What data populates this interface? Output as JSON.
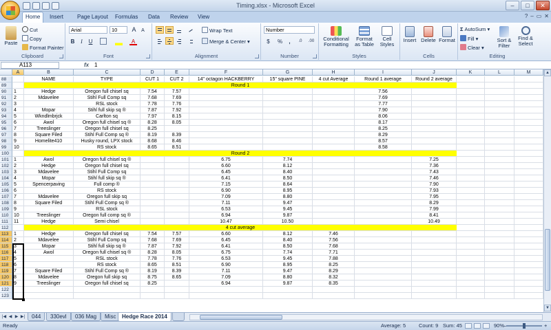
{
  "app": {
    "title": "Timing.xlsx - Microsoft Excel"
  },
  "window_controls": {
    "minimize": "–",
    "maximize": "□",
    "close": "✕"
  },
  "mdi_controls": {
    "minimize": "–",
    "restore": "▭",
    "close": "✕",
    "help": "?"
  },
  "ribbon": {
    "tabs": [
      "Home",
      "Insert",
      "Page Layout",
      "Formulas",
      "Data",
      "Review",
      "View"
    ],
    "active_tab": "Home",
    "clipboard": {
      "paste": "Paste",
      "cut": "Cut",
      "copy": "Copy",
      "format_painter": "Format Painter",
      "label": "Clipboard"
    },
    "font": {
      "name": "Arial",
      "size": "10",
      "grow": "A",
      "shrink": "A",
      "bold": "B",
      "italic": "I",
      "underline": "U",
      "font_color_letter": "A",
      "label": "Font"
    },
    "alignment": {
      "wrap_text": "Wrap Text",
      "merge_center": "Merge & Center",
      "label": "Alignment"
    },
    "number": {
      "format": "Number",
      "currency": "$",
      "percent": "%",
      "comma": ",",
      "inc_decimal": ".0",
      "dec_decimal": ".00",
      "label": "Number"
    },
    "styles": {
      "conditional": "Conditional Formatting",
      "format_table": "Format as Table",
      "cell_styles": "Cell Styles",
      "label": "Styles"
    },
    "cells": {
      "insert": "Insert",
      "delete": "Delete",
      "format": "Format",
      "label": "Cells"
    },
    "editing": {
      "autosum": "AutoSum",
      "fill": "Fill",
      "clear": "Clear",
      "sort_filter": "Sort & Filter",
      "find_select": "Find & Select",
      "label": "Editing"
    }
  },
  "formula_bar": {
    "name_box": "A113",
    "fx": "fx",
    "value": "1"
  },
  "sheet": {
    "columns": [
      "A",
      "B",
      "C",
      "D",
      "E",
      "F",
      "G",
      "H",
      "I",
      "J",
      "K",
      "L",
      "M"
    ],
    "selected_column": "A",
    "header_row": {
      "row": "88",
      "cells": [
        "",
        "NAME",
        "TYPE",
        "CUT 1",
        "CUT 2",
        "14\" octagon HACKBERRY",
        "15\" square PINE",
        "4 cut Average",
        "Round 1 average",
        "Round 2 average",
        "",
        "",
        ""
      ]
    },
    "blank_row": "89",
    "rows": [
      {
        "row": "89",
        "band": "Round 1"
      },
      {
        "row": "90",
        "cells": [
          "1",
          "Hedge",
          "Oregon full chisel sq",
          "7.54",
          "7.57",
          "",
          "",
          "",
          "7.56",
          "",
          "",
          "",
          ""
        ]
      },
      {
        "row": "91",
        "cells": [
          "2",
          "Mdavelee",
          "Stihl Full Comp sq",
          "7.68",
          "7.69",
          "",
          "",
          "",
          "7.69",
          "",
          "",
          "",
          ""
        ]
      },
      {
        "row": "92",
        "cells": [
          "3",
          "",
          "RSL stock",
          "7.78",
          "7.76",
          "",
          "",
          "",
          "7.77",
          "",
          "",
          "",
          ""
        ]
      },
      {
        "row": "93",
        "cells": [
          "4",
          "Mopar",
          "Stihl full skip sq ®",
          "7.87",
          "7.92",
          "",
          "",
          "",
          "7.90",
          "",
          "",
          "",
          ""
        ]
      },
      {
        "row": "94",
        "cells": [
          "5",
          "Wkndlmbrjck",
          "Carlton sq",
          "7.97",
          "8.15",
          "",
          "",
          "",
          "8.06",
          "",
          "",
          "",
          ""
        ]
      },
      {
        "row": "95",
        "cells": [
          "6",
          "Awol",
          "Oregon full chisel sq ®",
          "8.28",
          "8.05",
          "",
          "",
          "",
          "8.17",
          "",
          "",
          "",
          ""
        ]
      },
      {
        "row": "96",
        "cells": [
          "7",
          "Treeslinger",
          "Oregon full chisel sq",
          "8.25",
          "",
          "",
          "",
          "",
          "8.25",
          "",
          "",
          "",
          ""
        ]
      },
      {
        "row": "97",
        "cells": [
          "8",
          "Square Filed",
          "Stihl Full Comp sq ®",
          "8.19",
          "8.39",
          "",
          "",
          "",
          "8.29",
          "",
          "",
          "",
          ""
        ]
      },
      {
        "row": "98",
        "cells": [
          "9",
          "Homelite410",
          "Husky round, LPX stock",
          "8.68",
          "8.46",
          "",
          "",
          "",
          "8.57",
          "",
          "",
          "",
          ""
        ]
      },
      {
        "row": "99",
        "cells": [
          "10",
          "",
          "RS stock",
          "8.65",
          "8.51",
          "",
          "",
          "",
          "8.58",
          "",
          "",
          "",
          ""
        ]
      },
      {
        "row": "100",
        "band": "Round 2"
      },
      {
        "row": "101",
        "cells": [
          "1",
          "Awol",
          "Oregon full chisel sq ®",
          "",
          "",
          "6.75",
          "7.74",
          "",
          "",
          "7.25",
          "",
          "",
          ""
        ]
      },
      {
        "row": "102",
        "cells": [
          "2",
          "Hedge",
          "Oregon full chisel sq",
          "",
          "",
          "6.60",
          "8.12",
          "",
          "",
          "7.36",
          "",
          "",
          ""
        ]
      },
      {
        "row": "103",
        "cells": [
          "3",
          "Mdavelee",
          "Stihl Full Comp sq",
          "",
          "",
          "6.45",
          "8.40",
          "",
          "",
          "7.43",
          "",
          "",
          ""
        ]
      },
      {
        "row": "104",
        "cells": [
          "4",
          "Mopar",
          "Stihl full skip sq ®",
          "",
          "",
          "6.41",
          "8.50",
          "",
          "",
          "7.46",
          "",
          "",
          ""
        ]
      },
      {
        "row": "105",
        "cells": [
          "5",
          "Spencerpaving",
          "Full comp ®",
          "",
          "",
          "7.15",
          "8.64",
          "",
          "",
          "7.90",
          "",
          "",
          ""
        ]
      },
      {
        "row": "106",
        "cells": [
          "6",
          "",
          "RS stock",
          "",
          "",
          "6.90",
          "8.95",
          "",
          "",
          "7.93",
          "",
          "",
          ""
        ]
      },
      {
        "row": "107",
        "cells": [
          "7",
          "Mdavelee",
          "Oregon full skip sq",
          "",
          "",
          "7.09",
          "8.80",
          "",
          "",
          "7.95",
          "",
          "",
          ""
        ]
      },
      {
        "row": "108",
        "cells": [
          "8",
          "Square Filed",
          "Stihl Full Comp sq ®",
          "",
          "",
          "7.11",
          "9.47",
          "",
          "",
          "8.29",
          "",
          "",
          ""
        ]
      },
      {
        "row": "109",
        "cells": [
          "9",
          "",
          "RSL stock",
          "",
          "",
          "6.53",
          "9.45",
          "",
          "",
          "7.99",
          "",
          "",
          ""
        ]
      },
      {
        "row": "110",
        "cells": [
          "10",
          "Treeslinger",
          "Oregon full comp sq ®",
          "",
          "",
          "6.94",
          "9.87",
          "",
          "",
          "8.41",
          "",
          "",
          ""
        ]
      },
      {
        "row": "111",
        "cells": [
          "11",
          "Hedge",
          "Semi chisel",
          "",
          "",
          "10.47",
          "10.50",
          "",
          "",
          "10.49",
          "",
          "",
          ""
        ]
      },
      {
        "row": "112",
        "band": "4 cut average"
      },
      {
        "row": "113",
        "cells": [
          "1",
          "Hedge",
          "Oregon full chisel sq",
          "7.54",
          "7.57",
          "6.60",
          "8.12",
          "7.46",
          "",
          "",
          "",
          "",
          ""
        ]
      },
      {
        "row": "114",
        "cells": [
          "2",
          "Mdavelee",
          "Stihl Full Comp sq",
          "7.68",
          "7.69",
          "6.45",
          "8.40",
          "7.56",
          "",
          "",
          "",
          "",
          ""
        ]
      },
      {
        "row": "115",
        "cells": [
          "3",
          "Mopar",
          "Stihl full skip sq ®",
          "7.87",
          "7.92",
          "6.41",
          "8.50",
          "7.68",
          "",
          "",
          "",
          "",
          ""
        ]
      },
      {
        "row": "116",
        "cells": [
          "4",
          "Awol",
          "Oregon full chisel sq ®",
          "8.28",
          "8.05",
          "6.75",
          "7.74",
          "7.71",
          "",
          "",
          "",
          "",
          ""
        ]
      },
      {
        "row": "117",
        "cells": [
          "5",
          "",
          "RSL stock",
          "7.78",
          "7.76",
          "6.53",
          "9.45",
          "7.88",
          "",
          "",
          "",
          "",
          ""
        ]
      },
      {
        "row": "118",
        "cells": [
          "6",
          "",
          "RS stock",
          "8.65",
          "8.51",
          "6.90",
          "8.95",
          "8.25",
          "",
          "",
          "",
          "",
          ""
        ]
      },
      {
        "row": "119",
        "cells": [
          "7",
          "Square Filed",
          "Stihl Full Comp sq ®",
          "8.19",
          "8.39",
          "7.11",
          "9.47",
          "8.29",
          "",
          "",
          "",
          "",
          ""
        ]
      },
      {
        "row": "120",
        "cells": [
          "8",
          "Mdavelee",
          "Oregon full skip sq",
          "8.75",
          "8.65",
          "7.09",
          "8.80",
          "8.32",
          "",
          "",
          "",
          "",
          ""
        ]
      },
      {
        "row": "121",
        "cells": [
          "9",
          "Treeslinger",
          "Oregon full chisel sq",
          "8.25",
          "",
          "6.94",
          "9.87",
          "8.35",
          "",
          "",
          "",
          "",
          ""
        ]
      },
      {
        "row": "122",
        "cells": [
          "",
          "",
          "",
          "",
          "",
          "",
          "",
          "",
          "",
          "",
          "",
          "",
          ""
        ]
      },
      {
        "row": "123",
        "cells": [
          "",
          "",
          "",
          "",
          "",
          "",
          "",
          "",
          "",
          "",
          "",
          "",
          ""
        ]
      }
    ]
  },
  "sheet_tabs": {
    "tabs": [
      "044",
      "330evl",
      "036 Mag",
      "Misc",
      "Hedge Race 2014"
    ],
    "active": "Hedge Race 2014"
  },
  "status_bar": {
    "mode": "Ready",
    "average": "Average: 5",
    "count": "Count: 9",
    "sum": "Sum: 45",
    "zoom": "90%",
    "zoom_minus": "–",
    "zoom_plus": "+"
  }
}
